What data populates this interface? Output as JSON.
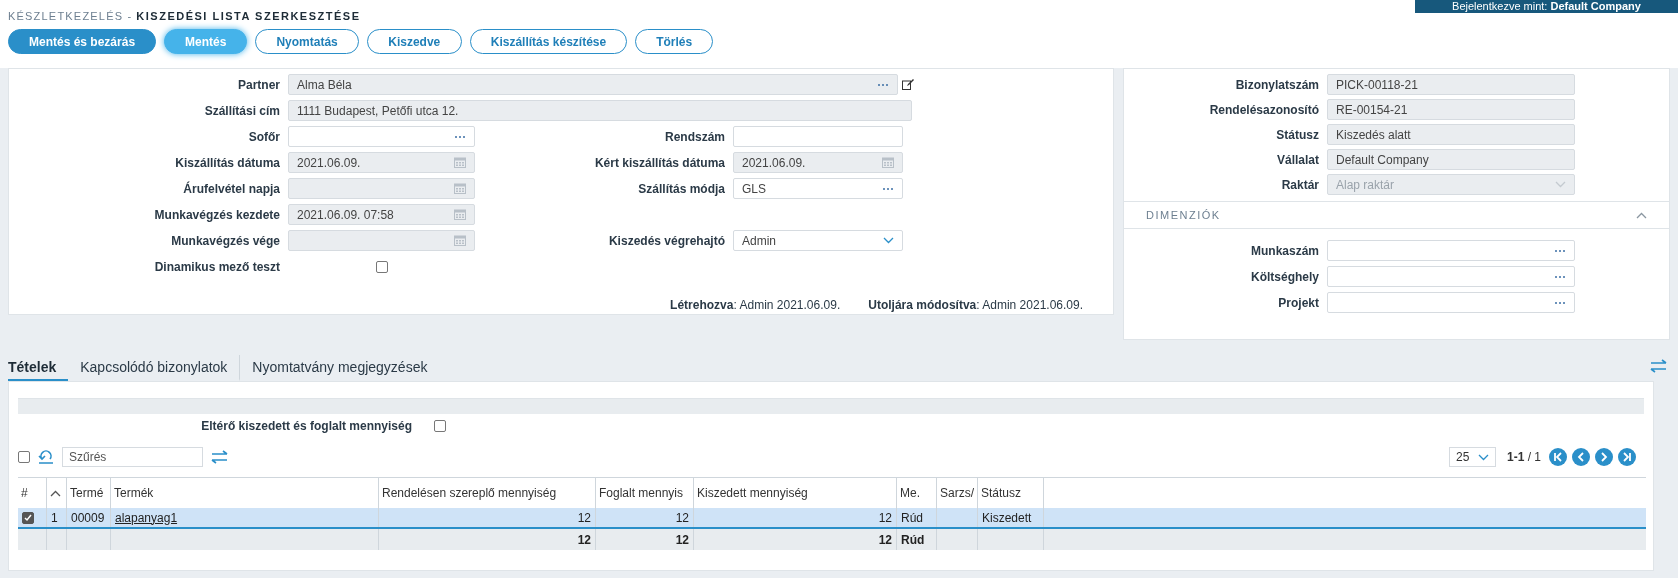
{
  "breadcrumb": {
    "section": "KÉSZLETKEZELÉS -",
    "title": "KISZEDÉSI LISTA SZERKESZTÉSE"
  },
  "user_badge": "Bejelentkezve mint: **Default Company**",
  "buttons": [
    {
      "label": "Mentés és bezárás",
      "kind": "primary"
    },
    {
      "label": "Mentés",
      "kind": "secondary"
    },
    {
      "label": "Nyomtatás",
      "kind": "outline"
    },
    {
      "label": "Kiszedve",
      "kind": "outline"
    },
    {
      "label": "Kiszállítás készítése",
      "kind": "outline"
    },
    {
      "label": "Törlés",
      "kind": "outline"
    }
  ],
  "form": {
    "wide_fields": [
      {
        "label": "Partner",
        "value": "Alma Béla",
        "kind": "lookup",
        "disabled": true,
        "editable": true
      },
      {
        "label": "Szállítási cím",
        "value": "1111 Budapest, Petőfi utca 12.",
        "kind": "text",
        "disabled": true,
        "editable": false
      }
    ],
    "rows": [
      {
        "left": {
          "label": "Sofőr",
          "kind": "lookup",
          "disabled": false
        },
        "right": {
          "label": "Rendszám",
          "kind": "text",
          "disabled": false
        }
      },
      {
        "left": {
          "label": "Kiszállítás dátuma",
          "value": "2021.06.09.",
          "kind": "date",
          "disabled": true
        },
        "right": {
          "label": "Kért kiszállítás dátuma",
          "value": "2021.06.09.",
          "kind": "date",
          "disabled": true
        }
      },
      {
        "left": {
          "label": "Árufelvétel napja",
          "kind": "date",
          "disabled": true
        },
        "right": {
          "label": "Szállítás módja",
          "value": "GLS",
          "kind": "lookup",
          "disabled": false
        }
      },
      {
        "left": {
          "label": "Munkavégzés kezdete",
          "value": "2021.06.09. 07:58",
          "kind": "date",
          "disabled": true
        },
        "right": null
      },
      {
        "left": {
          "label": "Munkavégzés vége",
          "kind": "date",
          "disabled": true
        },
        "right": {
          "label": "Kiszedés végrehajtó",
          "value": "Admin",
          "kind": "select",
          "disabled": false
        }
      },
      {
        "left": {
          "label": "Dinamikus mező teszt",
          "kind": "checkbox",
          "checked": false
        },
        "right": null
      }
    ],
    "footer": [
      "**Létrehozva**: Admin 2021.06.09.",
      "**Utoljára módosítva**: Admin 2021.06.09."
    ]
  },
  "side": {
    "fields": [
      {
        "label": "Bizonylatszám",
        "value": "PICK-00118-21",
        "kind": "text",
        "disabled": true
      },
      {
        "label": "Rendelésazonosító",
        "value": "RE-00154-21",
        "kind": "text",
        "disabled": true
      },
      {
        "label": "Státusz",
        "value": "Kiszedés alatt",
        "kind": "text",
        "disabled": true
      },
      {
        "label": "Vállalat",
        "value": "Default Company",
        "kind": "text",
        "disabled": true
      },
      {
        "label": "Raktár",
        "value": "Alap raktár",
        "kind": "select",
        "disabled": true
      }
    ],
    "section": {
      "title": "DIMENZIÓK",
      "expanded": true,
      "fields": [
        {
          "label": "Munkaszám",
          "kind": "lookup",
          "disabled": false
        },
        {
          "label": "Költséghely",
          "kind": "lookup",
          "disabled": false
        },
        {
          "label": "Projekt",
          "kind": "lookup",
          "disabled": false
        }
      ]
    }
  },
  "tabs": [
    {
      "label": "Tételek",
      "selected": true
    },
    {
      "label": "Kapcsolódó bizonylatok",
      "selected": false
    },
    {
      "label": "Nyomtatvány megjegyzések",
      "selected": false
    }
  ],
  "filter_option": {
    "label": "Eltérő kiszedett és foglalt mennyiség",
    "checked": false
  },
  "toolbar": {
    "select_all": false,
    "search": {
      "placeholder": "Szűrés"
    },
    "page_size": "25",
    "page_info": "**1-1** / 1"
  },
  "table": {
    "columns": [
      {
        "label": "#",
        "kind": "check"
      },
      {
        "kind": "sort"
      },
      {
        "label": "Termé",
        "kind": "text"
      },
      {
        "label": "Termék",
        "kind": "link"
      },
      {
        "label": "Rendelésen szereplő mennyiség",
        "kind": "number"
      },
      {
        "label": "Foglalt mennyis",
        "kind": "number"
      },
      {
        "label": "Kiszedett mennyiség",
        "kind": "number"
      },
      {
        "label": "Me.",
        "kind": "text"
      },
      {
        "label": "Sarzs/",
        "kind": "text"
      },
      {
        "label": "Státusz",
        "kind": "text"
      },
      {
        "kind": "filler"
      }
    ],
    "rows": [
      {
        "selected": true,
        "checked": true,
        "cells": [
          null,
          "1",
          "00009",
          "alapanyag1",
          "12",
          "12",
          "12",
          "Rúd",
          null,
          "Kiszedett",
          null
        ]
      }
    ],
    "totals": {
      "ordered_quantity": "12",
      "reserved_quantity": "12",
      "picked_quantity": "12",
      "unit": "Rúd"
    }
  }
}
